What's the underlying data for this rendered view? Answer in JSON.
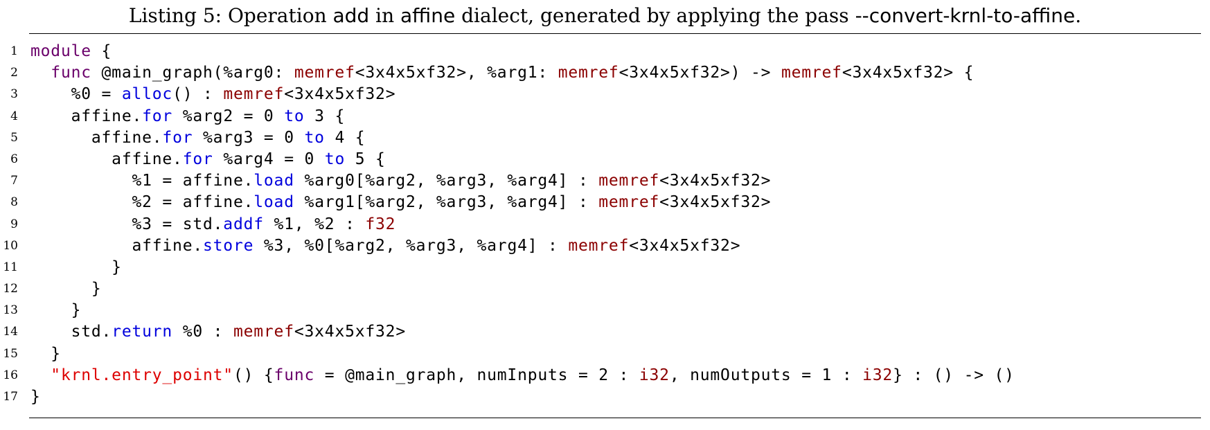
{
  "caption": {
    "prefix": "Listing 5: Operation ",
    "op": "add",
    "mid": " in ",
    "dialect": "affine",
    "suffix": " dialect, generated by applying the pass ",
    "pass": "--convert-krnl-to-affine",
    "end": "."
  },
  "colors": {
    "keyword": "#6a006a",
    "function": "#0000dd",
    "type": "#8b0000",
    "string": "#dd0000",
    "text": "#000000"
  },
  "lines": [
    {
      "n": "1",
      "tokens": [
        {
          "t": "",
          "c": ""
        },
        {
          "t": "module",
          "c": "kw"
        },
        {
          "t": " {",
          "c": ""
        }
      ]
    },
    {
      "n": "2",
      "tokens": [
        {
          "t": "  ",
          "c": ""
        },
        {
          "t": "func",
          "c": "kw"
        },
        {
          "t": " @main_graph(%arg0: ",
          "c": ""
        },
        {
          "t": "memref",
          "c": "ty"
        },
        {
          "t": "<3x4x5xf32>, %arg1: ",
          "c": ""
        },
        {
          "t": "memref",
          "c": "ty"
        },
        {
          "t": "<3x4x5xf32>) -> ",
          "c": ""
        },
        {
          "t": "memref",
          "c": "ty"
        },
        {
          "t": "<3x4x5xf32> {",
          "c": ""
        }
      ]
    },
    {
      "n": "3",
      "tokens": [
        {
          "t": "    %0 = ",
          "c": ""
        },
        {
          "t": "alloc",
          "c": "fn"
        },
        {
          "t": "() : ",
          "c": ""
        },
        {
          "t": "memref",
          "c": "ty"
        },
        {
          "t": "<3x4x5xf32>",
          "c": ""
        }
      ]
    },
    {
      "n": "4",
      "tokens": [
        {
          "t": "    affine.",
          "c": ""
        },
        {
          "t": "for",
          "c": "fn"
        },
        {
          "t": " %arg2 = 0 ",
          "c": ""
        },
        {
          "t": "to",
          "c": "fn"
        },
        {
          "t": " 3 {",
          "c": ""
        }
      ]
    },
    {
      "n": "5",
      "tokens": [
        {
          "t": "      affine.",
          "c": ""
        },
        {
          "t": "for",
          "c": "fn"
        },
        {
          "t": " %arg3 = 0 ",
          "c": ""
        },
        {
          "t": "to",
          "c": "fn"
        },
        {
          "t": " 4 {",
          "c": ""
        }
      ]
    },
    {
      "n": "6",
      "tokens": [
        {
          "t": "        affine.",
          "c": ""
        },
        {
          "t": "for",
          "c": "fn"
        },
        {
          "t": " %arg4 = 0 ",
          "c": ""
        },
        {
          "t": "to",
          "c": "fn"
        },
        {
          "t": " 5 {",
          "c": ""
        }
      ]
    },
    {
      "n": "7",
      "tokens": [
        {
          "t": "          %1 = affine.",
          "c": ""
        },
        {
          "t": "load",
          "c": "fn"
        },
        {
          "t": " %arg0[%arg2, %arg3, %arg4] : ",
          "c": ""
        },
        {
          "t": "memref",
          "c": "ty"
        },
        {
          "t": "<3x4x5xf32>",
          "c": ""
        }
      ]
    },
    {
      "n": "8",
      "tokens": [
        {
          "t": "          %2 = affine.",
          "c": ""
        },
        {
          "t": "load",
          "c": "fn"
        },
        {
          "t": " %arg1[%arg2, %arg3, %arg4] : ",
          "c": ""
        },
        {
          "t": "memref",
          "c": "ty"
        },
        {
          "t": "<3x4x5xf32>",
          "c": ""
        }
      ]
    },
    {
      "n": "9",
      "tokens": [
        {
          "t": "          %3 = std.",
          "c": ""
        },
        {
          "t": "addf",
          "c": "fn"
        },
        {
          "t": " %1, %2 : ",
          "c": ""
        },
        {
          "t": "f32",
          "c": "ty"
        }
      ]
    },
    {
      "n": "10",
      "tokens": [
        {
          "t": "          affine.",
          "c": ""
        },
        {
          "t": "store",
          "c": "fn"
        },
        {
          "t": " %3, %0[%arg2, %arg3, %arg4] : ",
          "c": ""
        },
        {
          "t": "memref",
          "c": "ty"
        },
        {
          "t": "<3x4x5xf32>",
          "c": ""
        }
      ]
    },
    {
      "n": "11",
      "tokens": [
        {
          "t": "        }",
          "c": ""
        }
      ]
    },
    {
      "n": "12",
      "tokens": [
        {
          "t": "      }",
          "c": ""
        }
      ]
    },
    {
      "n": "13",
      "tokens": [
        {
          "t": "    }",
          "c": ""
        }
      ]
    },
    {
      "n": "14",
      "tokens": [
        {
          "t": "    std.",
          "c": ""
        },
        {
          "t": "return",
          "c": "fn"
        },
        {
          "t": " %0 : ",
          "c": ""
        },
        {
          "t": "memref",
          "c": "ty"
        },
        {
          "t": "<3x4x5xf32>",
          "c": ""
        }
      ]
    },
    {
      "n": "15",
      "tokens": [
        {
          "t": "  }",
          "c": ""
        }
      ]
    },
    {
      "n": "16",
      "tokens": [
        {
          "t": "  ",
          "c": ""
        },
        {
          "t": "\"krnl.entry_point\"",
          "c": "str"
        },
        {
          "t": "() {",
          "c": ""
        },
        {
          "t": "func",
          "c": "kw"
        },
        {
          "t": " = @main_graph, numInputs = 2 : ",
          "c": ""
        },
        {
          "t": "i32",
          "c": "ty"
        },
        {
          "t": ", numOutputs = 1 : ",
          "c": ""
        },
        {
          "t": "i32",
          "c": "ty"
        },
        {
          "t": "} : () -> ()",
          "c": ""
        }
      ]
    },
    {
      "n": "17",
      "tokens": [
        {
          "t": "}",
          "c": ""
        }
      ]
    }
  ]
}
